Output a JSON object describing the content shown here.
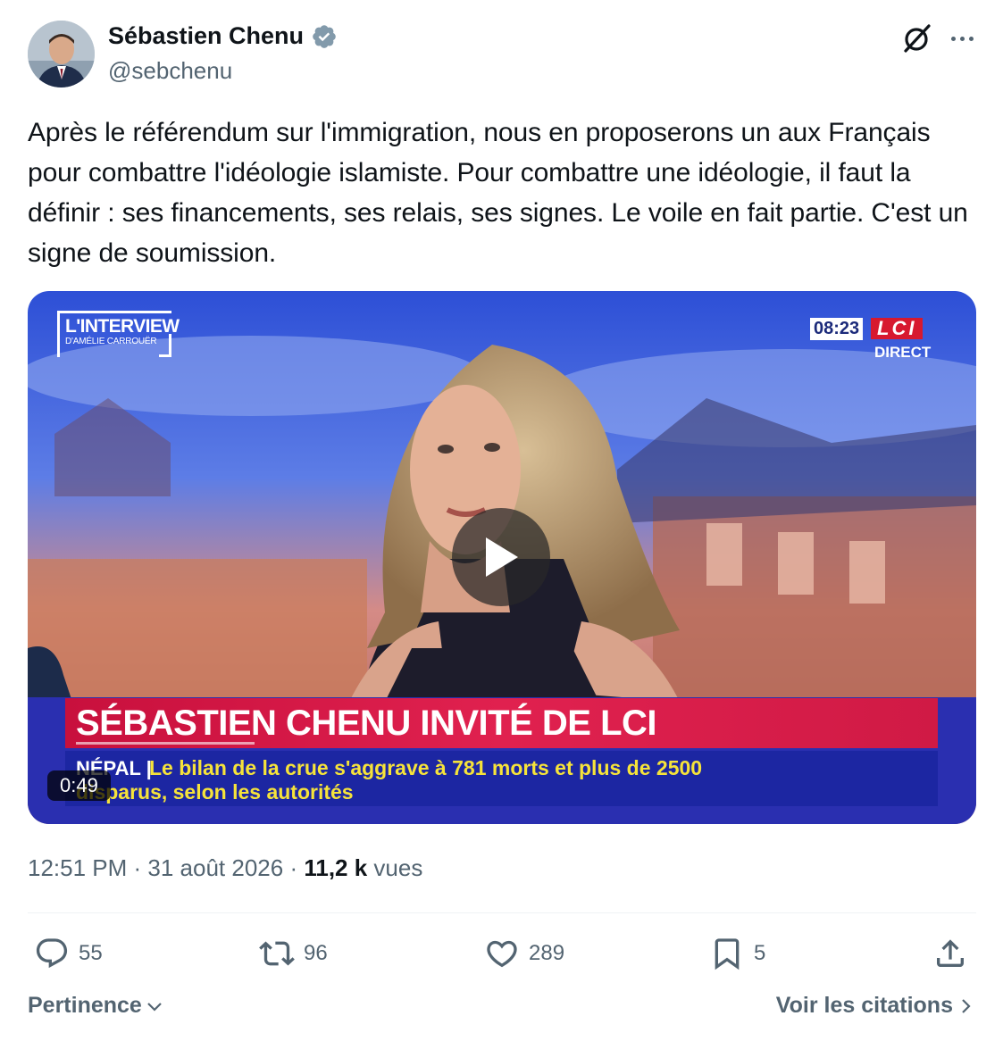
{
  "author": {
    "name": "Sébastien Chenu",
    "handle": "@sebchenu",
    "verified_icon": "verified-badge-icon"
  },
  "tweet": {
    "text": "Après le référendum sur l'immigration, nous en proposerons un aux Français pour combattre l'idéologie islamiste. Pour combattre une idéologie, il faut la définir : ses financements, ses relais, ses signes. Le voile en fait partie. C'est un signe de soumission."
  },
  "video": {
    "duration": "0:49",
    "show_logo_line1": "L'INTERVIEW",
    "show_logo_line2": "D'AMÉLIE CARROUËR",
    "clock": "08:23",
    "channel": "LCI",
    "live_label": "DIRECT",
    "headline": "SÉBASTIEN CHENU INVITÉ DE LCI",
    "ticker_tag": "NÉPAL |",
    "ticker_line1": "Le bilan de la crue s'aggrave à 781 morts et plus de 2500",
    "ticker_line2": "disparus, selon les autorités"
  },
  "meta": {
    "time": "12:51 PM",
    "sep1": " · ",
    "date": "31 août 2026",
    "sep2": " · ",
    "views_count": "11,2 k",
    "views_label": " vues"
  },
  "actions": {
    "replies": "55",
    "reposts": "96",
    "likes": "289",
    "bookmarks": "5"
  },
  "footer": {
    "sort_label": "Pertinence",
    "quotes_label": "Voir les citations"
  },
  "colors": {
    "text_primary": "#0f1419",
    "text_secondary": "#536471",
    "verified_blue": "#829aab",
    "lci_red": "#d7192f"
  }
}
